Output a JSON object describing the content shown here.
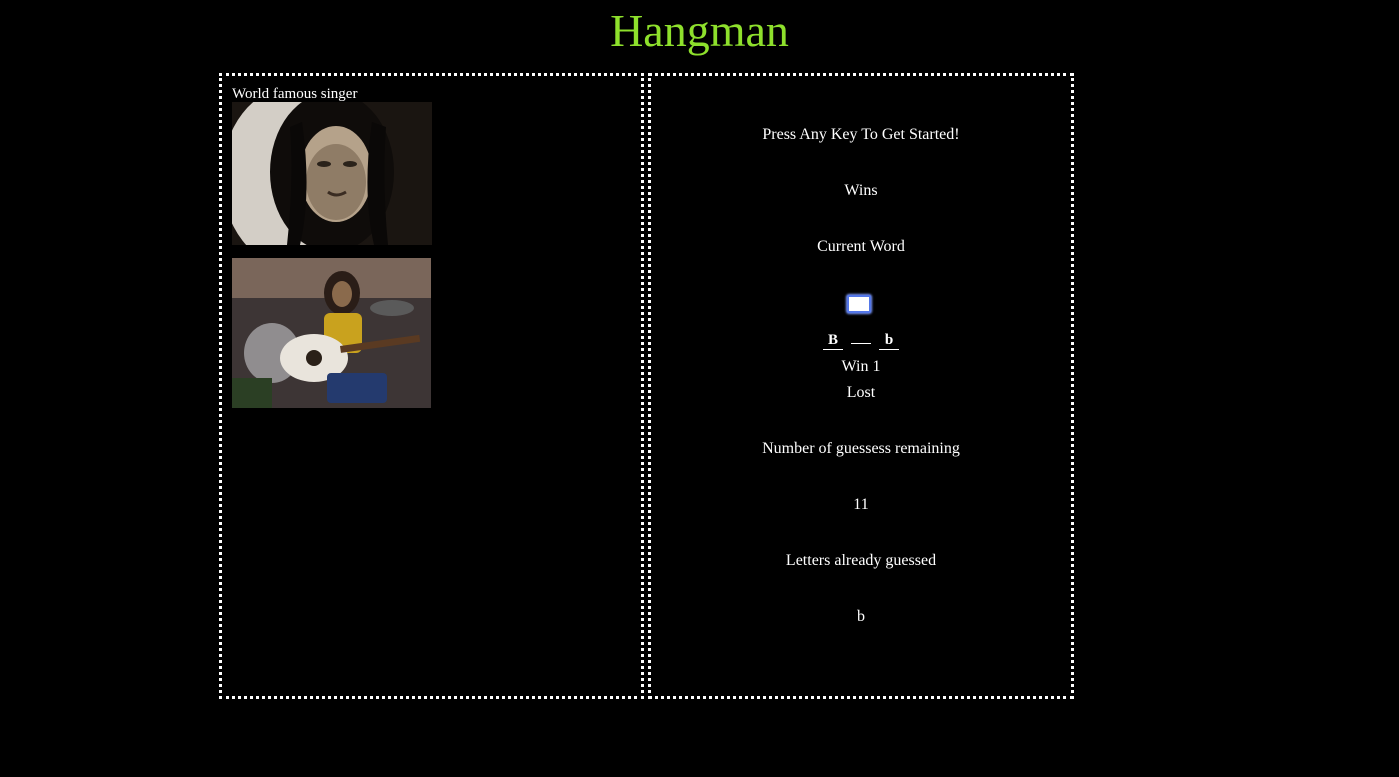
{
  "page": {
    "title": "Hangman",
    "title_color": "#8ee02c"
  },
  "hint_panel": {
    "hint": "World famous singer",
    "images": [
      "portrait-photo",
      "guitar-photo"
    ]
  },
  "game_panel": {
    "prompt": "Press Any Key To Get Started!",
    "wins_heading": "Wins",
    "current_word_heading": "Current Word",
    "word_slots": [
      "B",
      "",
      "b"
    ],
    "wins_line": "Win 1",
    "lost_line": "Lost",
    "guesses_heading": "Number of guessess remaining",
    "guesses_remaining": "11",
    "guessed_heading": "Letters already guessed",
    "guessed_letters": "b"
  }
}
